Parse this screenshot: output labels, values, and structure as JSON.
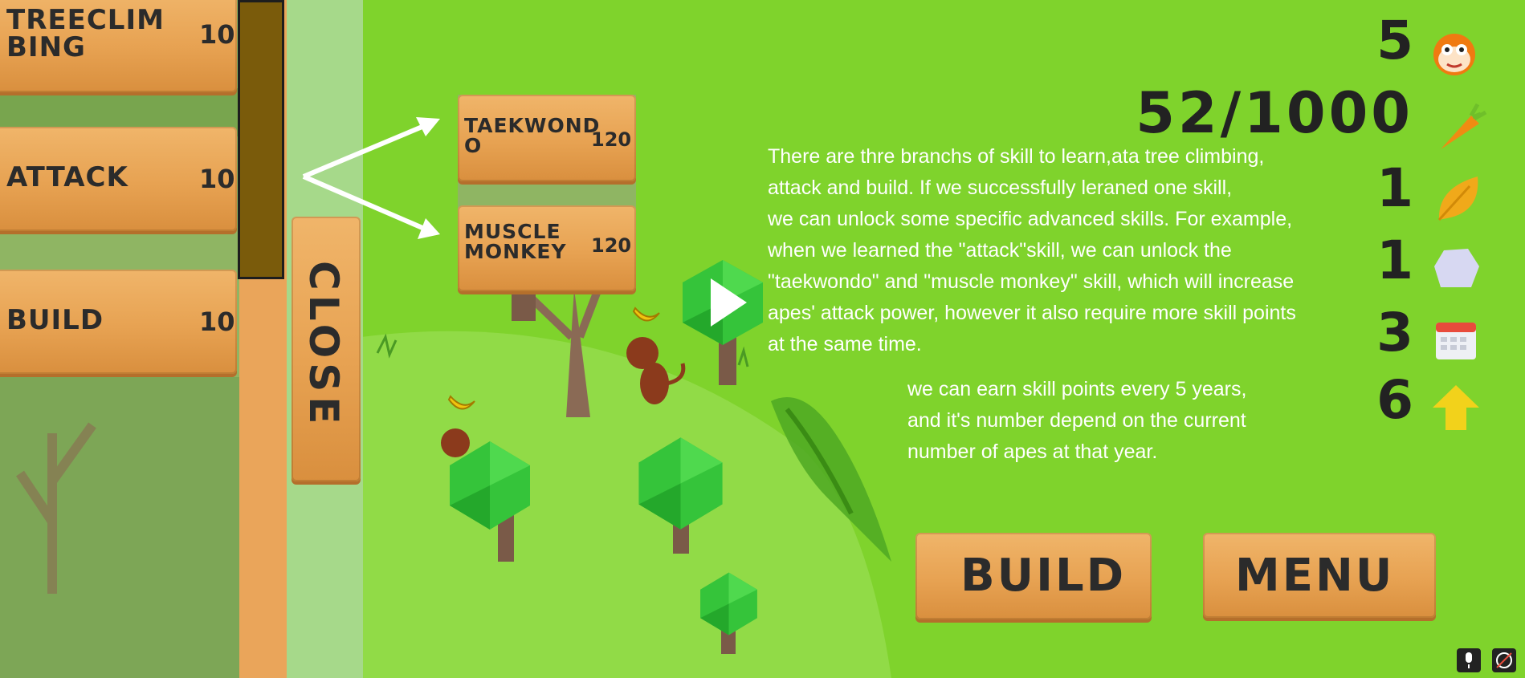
{
  "skills_panel": {
    "items": [
      {
        "name": "TREECLIM\nBING",
        "cost": "10"
      },
      {
        "name": "ATTACK",
        "cost": "10"
      },
      {
        "name": "BUILD",
        "cost": "10"
      }
    ],
    "close_label": "CLOSE"
  },
  "advanced_skills": [
    {
      "name": "TAEKWOND\nO",
      "cost": "120"
    },
    {
      "name": "MUSCLE\nMONKEY",
      "cost": "120"
    }
  ],
  "stats": {
    "apes": "5",
    "food": "52/1000",
    "leaves": "1",
    "stone": "1",
    "year": "3",
    "skill_points": "6"
  },
  "info": {
    "paragraph1": "There are thre branchs of skill to learn,ata tree climbing,\nattack and build. If we successfully leraned one skill,\nwe can unlock some specific advanced skills. For example,\nwhen we learned the \"attack\"skill, we can unlock the\n\"taekwondo\" and \"muscle monkey\" skill, which will increase\napes' attack power, however it also require more skill points\nat the same time.",
    "paragraph2": "we can earn skill points every 5 years,\nand it's number depend on the current\nnumber of apes at that year."
  },
  "buttons": {
    "build": "BUILD",
    "menu": "MENU"
  },
  "icons": [
    "monkey-face-icon",
    "carrot-icon",
    "leaf-icon",
    "stone-icon",
    "calendar-icon",
    "up-arrow-icon",
    "play-icon",
    "microphone-icon",
    "rotate-icon"
  ],
  "colors": {
    "grass": "#7fd32c",
    "board": "#e7a252",
    "text_dark": "#222222"
  }
}
